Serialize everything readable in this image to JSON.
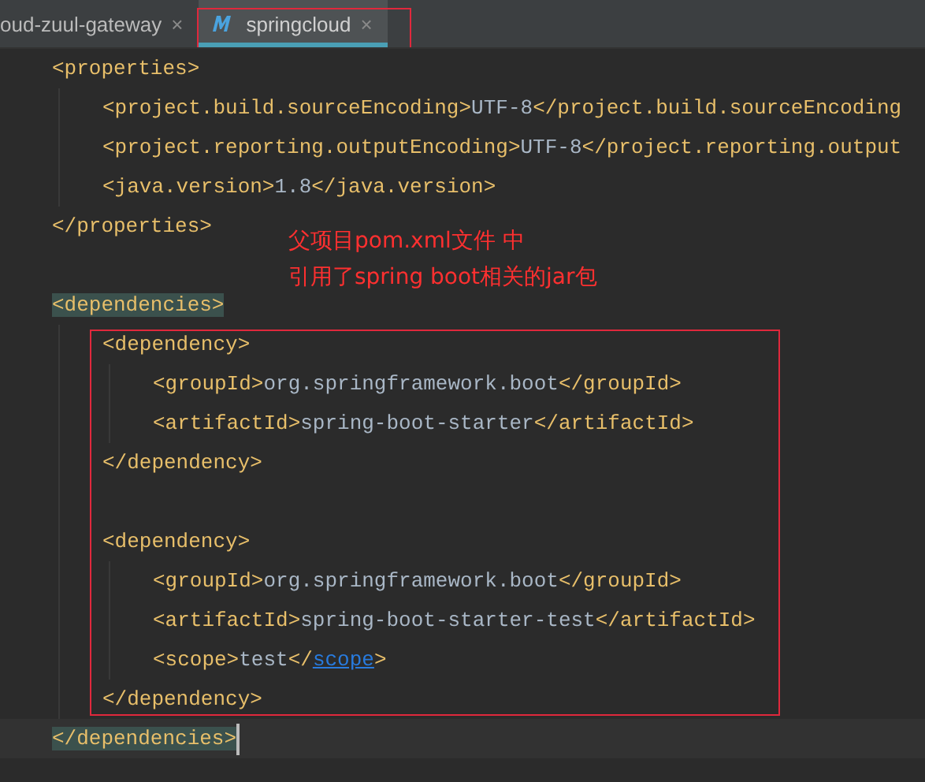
{
  "tabs": [
    {
      "label": "oud-zuul-gateway",
      "close": "×",
      "selected": false,
      "icon": false
    },
    {
      "label": "springcloud",
      "close": "×",
      "selected": true,
      "icon": true
    }
  ],
  "editor": {
    "lines": [
      {
        "kind": "code",
        "parts": [
          {
            "kind": "tag",
            "text": "<properties>"
          }
        ],
        "children": [
          {
            "kind": "code",
            "parts": [
              {
                "kind": "tag",
                "text": "<project.build.sourceEncoding>"
              },
              {
                "kind": "text",
                "text": "UTF-8"
              },
              {
                "kind": "tag",
                "text": "</project.build.sourceEncoding"
              }
            ]
          },
          {
            "kind": "code",
            "parts": [
              {
                "kind": "tag",
                "text": "<project.reporting.outputEncoding>"
              },
              {
                "kind": "text",
                "text": "UTF-8"
              },
              {
                "kind": "tag",
                "text": "</project.reporting.output"
              }
            ]
          },
          {
            "kind": "code",
            "parts": [
              {
                "kind": "tag",
                "text": "<java.version>"
              },
              {
                "kind": "text",
                "text": "1.8"
              },
              {
                "kind": "tag",
                "text": "</java.version>"
              }
            ]
          }
        ]
      },
      {
        "kind": "code",
        "parts": [
          {
            "kind": "tag",
            "text": "</properties>"
          }
        ]
      },
      {
        "kind": "blank"
      },
      {
        "kind": "code",
        "parts": [
          {
            "kind": "tag",
            "text": "<dependencies>",
            "matched": true
          }
        ],
        "children": [
          {
            "kind": "code",
            "parts": [
              {
                "kind": "tag",
                "text": "<dependency>"
              }
            ],
            "children": [
              {
                "kind": "code",
                "parts": [
                  {
                    "kind": "tag",
                    "text": "<groupId>"
                  },
                  {
                    "kind": "text",
                    "text": "org.springframework.boot"
                  },
                  {
                    "kind": "tag",
                    "text": "</groupId>"
                  }
                ]
              },
              {
                "kind": "code",
                "parts": [
                  {
                    "kind": "tag",
                    "text": "<artifactId>"
                  },
                  {
                    "kind": "text",
                    "text": "spring-boot-starter"
                  },
                  {
                    "kind": "tag",
                    "text": "</artifactId>"
                  }
                ]
              }
            ]
          },
          {
            "kind": "code",
            "parts": [
              {
                "kind": "tag",
                "text": "</dependency>"
              }
            ]
          },
          {
            "kind": "blank"
          },
          {
            "kind": "code",
            "parts": [
              {
                "kind": "tag",
                "text": "<dependency>"
              }
            ],
            "children": [
              {
                "kind": "code",
                "parts": [
                  {
                    "kind": "tag",
                    "text": "<groupId>"
                  },
                  {
                    "kind": "text",
                    "text": "org.springframework.boot"
                  },
                  {
                    "kind": "tag",
                    "text": "</groupId>"
                  }
                ]
              },
              {
                "kind": "code",
                "parts": [
                  {
                    "kind": "tag",
                    "text": "<artifactId>"
                  },
                  {
                    "kind": "text",
                    "text": "spring-boot-starter-test"
                  },
                  {
                    "kind": "tag",
                    "text": "</artifactId>"
                  }
                ]
              },
              {
                "kind": "code",
                "parts": [
                  {
                    "kind": "tag",
                    "text": "<scope>"
                  },
                  {
                    "kind": "text",
                    "text": "test"
                  },
                  {
                    "kind": "tag",
                    "text": "</"
                  },
                  {
                    "kind": "link",
                    "text": "scope"
                  },
                  {
                    "kind": "tag",
                    "text": ">"
                  }
                ]
              }
            ]
          },
          {
            "kind": "code",
            "parts": [
              {
                "kind": "tag",
                "text": "</dependency>"
              }
            ]
          }
        ]
      },
      {
        "kind": "code",
        "current": true,
        "parts": [
          {
            "kind": "tag",
            "text": "</dependencies>",
            "matched": true
          }
        ]
      }
    ]
  },
  "annotation": {
    "lines": [
      "父项目pom.xml文件 中",
      "引用了spring boot相关的jar包"
    ]
  }
}
